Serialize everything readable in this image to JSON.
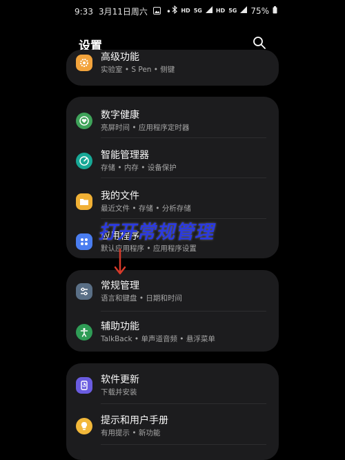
{
  "status_bar": {
    "time": "9:33",
    "date": "3月11日周六",
    "dot": "•",
    "hd1": "HD",
    "net1": "5G",
    "hd2": "HD",
    "net2": "5G",
    "battery": "75%"
  },
  "header": {
    "title": "设置"
  },
  "overlay": {
    "text": "打开常规管理"
  },
  "cards": [
    {
      "items": [
        {
          "title": "高级功能",
          "subtitle": "实验室 • S Pen • 侧键",
          "icon": "gear-star-icon",
          "color": "#f2a33c"
        }
      ]
    },
    {
      "items": [
        {
          "title": "数字健康",
          "subtitle": "亮屏时间 • 应用程序定时器",
          "icon": "heart-circle-icon",
          "color": "#3fa35a"
        },
        {
          "title": "智能管理器",
          "subtitle": "存储 • 内存 • 设备保护",
          "icon": "gauge-icon",
          "color": "#17a896"
        },
        {
          "title": "我的文件",
          "subtitle": "最近文件 • 存储 • 分析存储",
          "icon": "folder-icon",
          "color": "#f0b035"
        },
        {
          "title": "应用程序",
          "subtitle": "默认应用程序 • 应用程序设置",
          "icon": "apps-grid-icon",
          "color": "#4a7df0"
        }
      ]
    },
    {
      "items": [
        {
          "title": "常规管理",
          "subtitle": "语言和键盘 • 日期和时间",
          "icon": "sliders-icon",
          "color": "#5a6f86"
        },
        {
          "title": "辅助功能",
          "subtitle": "TalkBack • 单声道音频 • 悬浮菜单",
          "icon": "accessibility-icon",
          "color": "#2f9c56"
        }
      ]
    },
    {
      "items": [
        {
          "title": "软件更新",
          "subtitle": "下载并安装",
          "icon": "update-icon",
          "color": "#6a5ce0"
        },
        {
          "title": "提示和用户手册",
          "subtitle": "有用提示 • 新功能",
          "icon": "bulb-icon",
          "color": "#f2b83a"
        }
      ]
    }
  ]
}
